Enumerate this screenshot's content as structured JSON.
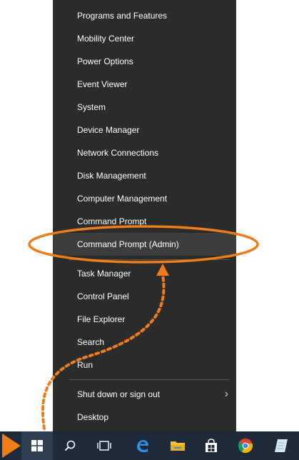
{
  "menu": {
    "items": [
      {
        "label": "Programs and Features"
      },
      {
        "label": "Mobility Center"
      },
      {
        "label": "Power Options"
      },
      {
        "label": "Event Viewer"
      },
      {
        "label": "System"
      },
      {
        "label": "Device Manager"
      },
      {
        "label": "Network Connections"
      },
      {
        "label": "Disk Management"
      },
      {
        "label": "Computer Management"
      },
      {
        "label": "Command Prompt"
      },
      {
        "label": "Command Prompt (Admin)"
      },
      {
        "label": "Task Manager"
      },
      {
        "label": "Control Panel"
      },
      {
        "label": "File Explorer"
      },
      {
        "label": "Search"
      },
      {
        "label": "Run"
      },
      {
        "label": "Shut down or sign out"
      },
      {
        "label": "Desktop"
      }
    ],
    "highlighted_item": "Command Prompt (Admin)"
  },
  "colors": {
    "menu_bg": "#2b2b2b",
    "annotation_orange": "#f07c1a",
    "taskbar_bg": "#1e2a3a"
  },
  "taskbar": {
    "icons": [
      "windows-start-icon",
      "search-icon",
      "task-view-icon",
      "edge-icon",
      "file-explorer-icon",
      "store-icon",
      "chrome-icon",
      "notepad-icon"
    ]
  }
}
